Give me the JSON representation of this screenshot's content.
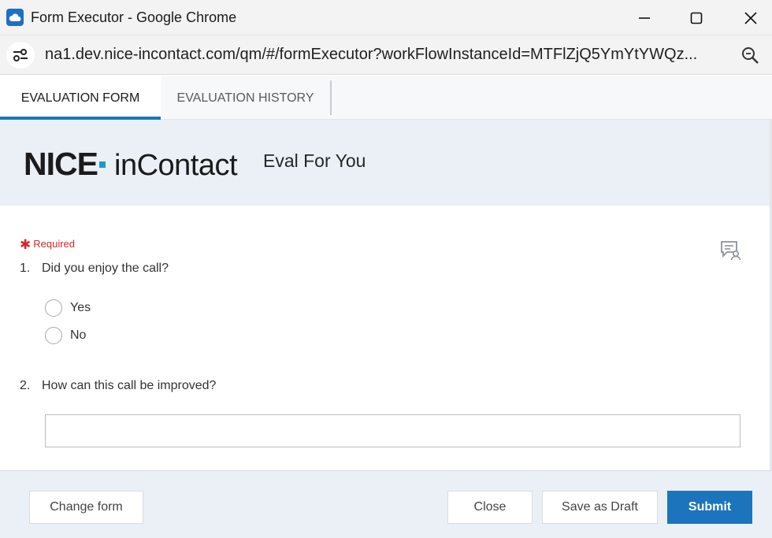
{
  "window": {
    "title": "Form Executor - Google Chrome",
    "url": "na1.dev.nice-incontact.com/qm/#/formExecutor?workFlowInstanceId=MTFlZjQ5YmYtYWQz..."
  },
  "tabs": [
    {
      "label": "EVALUATION FORM",
      "active": true
    },
    {
      "label": "EVALUATION HISTORY",
      "active": false
    }
  ],
  "header": {
    "logo_text": "NICE·inContact",
    "form_title": "Eval For You"
  },
  "form": {
    "required_label": "Required",
    "questions": [
      {
        "number": "1.",
        "text": "Did you enjoy the call?",
        "type": "radio",
        "options": [
          "Yes",
          "No"
        ],
        "selected": null
      },
      {
        "number": "2.",
        "text": "How can this call be improved?",
        "type": "text",
        "value": "",
        "placeholder": ""
      }
    ]
  },
  "footer": {
    "change_form": "Change form",
    "close": "Close",
    "save_draft": "Save as Draft",
    "submit": "Submit"
  },
  "colors": {
    "accent": "#1c75bc",
    "required": "#d3272d",
    "band": "#eaf0f6"
  }
}
